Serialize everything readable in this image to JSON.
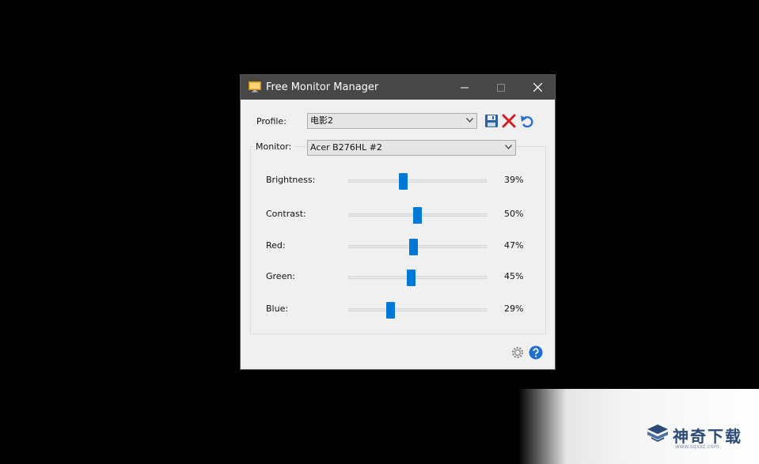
{
  "window": {
    "title": "Free Monitor Manager",
    "controls": {
      "minimize": "—",
      "maximize": "☐",
      "close": "✕"
    }
  },
  "profile": {
    "label": "Profile:",
    "selected": "电影2",
    "icons": [
      "save-icon",
      "delete-icon",
      "undo-icon"
    ]
  },
  "monitor": {
    "label": "Monitor:",
    "selected": "Acer B276HL #2"
  },
  "sliders": [
    {
      "label": "Brightness:",
      "value": 39,
      "value_text": "39%"
    },
    {
      "label": "Contrast:",
      "value": 50,
      "value_text": "50%"
    },
    {
      "label": "Red:",
      "value": 47,
      "value_text": "47%"
    },
    {
      "label": "Green:",
      "value": 45,
      "value_text": "45%"
    },
    {
      "label": "Blue:",
      "value": 29,
      "value_text": "29%"
    }
  ],
  "footer": {
    "icons": [
      "settings-icon",
      "help-icon"
    ]
  },
  "watermark": {
    "text": "神奇下载",
    "url": "www.sqxzz.com"
  },
  "colors": {
    "titlebar": "#474747",
    "accent": "#0078d7",
    "window_bg": "#f0f0f0",
    "delete": "#d21f1f",
    "help": "#1e6fd0"
  }
}
